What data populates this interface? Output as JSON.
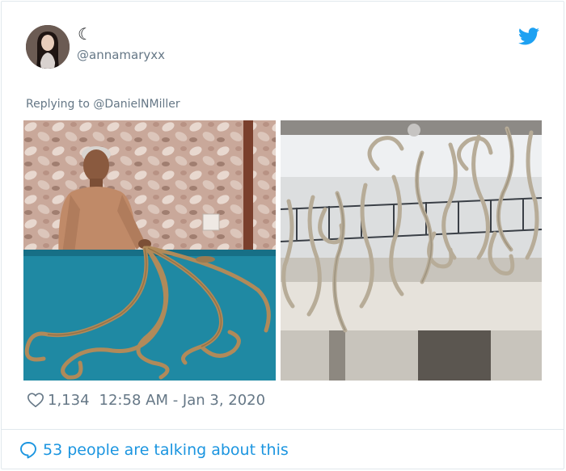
{
  "tweet": {
    "display_name": "☾",
    "handle": "@annamaryxx",
    "replying_prefix": "Replying to ",
    "replying_mention": "@DanielNMiller",
    "likes": "1,134",
    "timestamp": "12:58 AM - Jan 3, 2020",
    "talking": "53 people are talking about this"
  },
  "icons": {
    "logo": "twitter-bird-icon",
    "like": "heart-icon",
    "talking": "speech-bubble-icon"
  },
  "colors": {
    "accent": "#1b95e0",
    "muted": "#657786",
    "border": "#e1e8ed"
  }
}
